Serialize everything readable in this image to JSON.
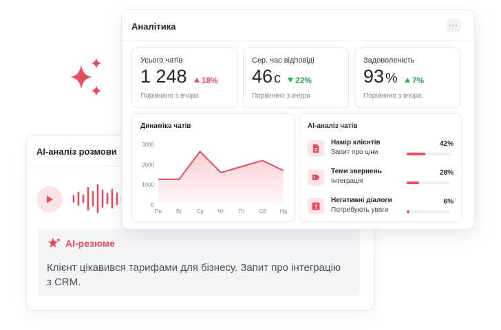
{
  "colors": {
    "accent": "#e84a5f",
    "accent_soft": "#fde2e6",
    "up": "#2fa84f",
    "muted": "#80858e"
  },
  "sparkles_icon": "sparkles-icon",
  "conversation": {
    "title": "AI-аналіз розмови",
    "play_icon": "play-icon",
    "waveform_icon": "audio-waveform-icon",
    "summary": {
      "icon": "ai-star-icon",
      "title": "AI-резюме",
      "text": "Клієнт цікавився тарифами для бізнесу. Запит про інтеграцію з CRM."
    }
  },
  "analytics": {
    "title": "Аналітика",
    "more_label": "···",
    "kpis": [
      {
        "label": "Усього чатів",
        "value": "1 248",
        "unit": "",
        "delta": "18%",
        "trend": "down",
        "sub": "Порівняно з вчора"
      },
      {
        "label": "Сер. час відповіді",
        "value": "46",
        "unit": "с",
        "delta": "22%",
        "trend": "up",
        "sub": "Порівняно з вчора"
      },
      {
        "label": "Задоволеність",
        "value": "93",
        "unit": "%",
        "delta": "7%",
        "trend": "up",
        "sub": "Порівняно з вчора"
      }
    ],
    "ai_panel": {
      "title": "AI-аналіз чатів",
      "items": [
        {
          "icon": "document-icon",
          "title": "Намір клієнтів",
          "sub": "Запит про ціни",
          "pct": "42%",
          "value": 0.42
        },
        {
          "icon": "tag-icon",
          "title": "Теми звернень",
          "sub": "Інтеграція",
          "pct": "28%",
          "value": 0.28
        },
        {
          "icon": "question-icon",
          "title": "Негативні діалоги",
          "sub": "Потребують уваги",
          "pct": "6%",
          "value": 0.06
        }
      ]
    }
  },
  "chart_data": {
    "type": "area",
    "title": "Динаміка чатів",
    "categories": [
      "Пн",
      "Вт",
      "Ср",
      "Чт",
      "Пт",
      "Сб",
      "Нд"
    ],
    "values": [
      1270,
      1270,
      2650,
      1600,
      1900,
      2200,
      1700
    ],
    "yticks": [
      0,
      1000,
      2000,
      3000
    ],
    "ylim": [
      0,
      3000
    ],
    "grid": false,
    "color": "#e84a5f"
  }
}
